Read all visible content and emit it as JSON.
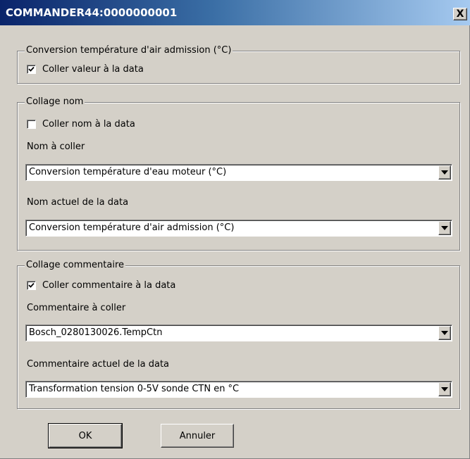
{
  "window": {
    "title": "COMMANDER44:0000000001",
    "close_glyph": "X"
  },
  "group_value": {
    "legend": "Conversion température d'air admission (°C)",
    "checkbox_label": "Coller valeur à la data",
    "checked": true
  },
  "group_name": {
    "legend": "Collage nom",
    "checkbox_label": "Coller nom à la data",
    "checked": false,
    "paste_label": "Nom à coller",
    "paste_value": "Conversion température d'eau moteur (°C)",
    "current_label": "Nom actuel de la data",
    "current_value": "Conversion température d'air admission (°C)"
  },
  "group_comment": {
    "legend": "Collage commentaire",
    "checkbox_label": "Coller commentaire à la data",
    "checked": true,
    "paste_label": "Commentaire à coller",
    "paste_value": "Bosch_0280130026.TempCtn",
    "current_label": "Commentaire actuel de la data",
    "current_value": "Transformation tension 0-5V sonde CTN en °C"
  },
  "buttons": {
    "ok": "OK",
    "cancel": "Annuler"
  },
  "icons": {
    "close": "close-icon",
    "check": "checkmark-icon",
    "dropdown": "chevron-down-icon"
  }
}
